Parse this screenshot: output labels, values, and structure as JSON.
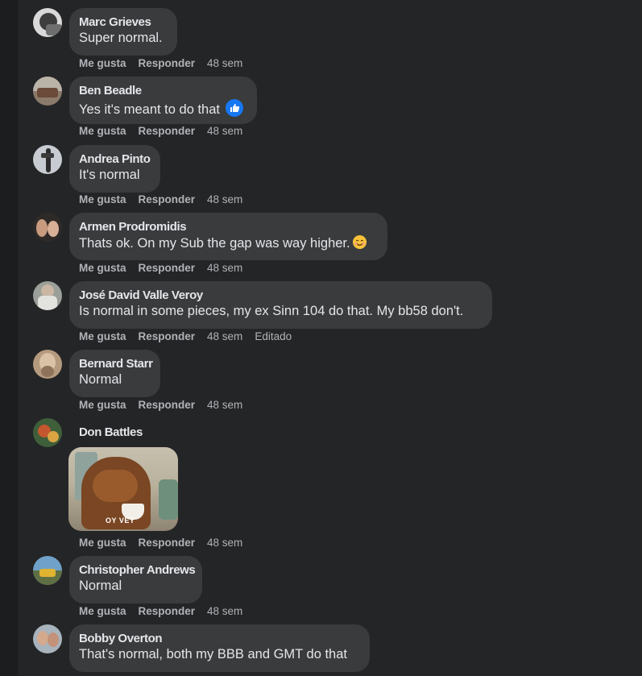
{
  "actions": {
    "like": "Me gusta",
    "reply": "Responder",
    "time": "48 sem",
    "edited": "Editado"
  },
  "comments": [
    {
      "author": "Marc Grieves",
      "text": "Super normal."
    },
    {
      "author": "Ben Beadle",
      "text": "Yes it's meant to do that"
    },
    {
      "author": "Andrea Pinto",
      "text": "It's normal"
    },
    {
      "author": "Armen Prodromidis",
      "text": "Thats ok. On my Sub the gap was way higher."
    },
    {
      "author": "José David Valle Veroy",
      "text": "Is normal in some pieces, my ex Sinn 104 do that. My bb58 don't."
    },
    {
      "author": "Bernard Starr",
      "text": "Normal"
    },
    {
      "author": "Don Battles",
      "gif_caption": "OY VEY"
    },
    {
      "author": "Christopher Andrews",
      "text": "Normal"
    },
    {
      "author": "Bobby Overton",
      "text": "That's normal, both my BBB and GMT do that"
    }
  ],
  "colors": {
    "bg": "#242526",
    "bubble": "#3a3b3c",
    "text": "#e4e6eb",
    "muted": "#b0b3b8",
    "like_blue": "#1877f2"
  },
  "icons": {
    "like_reaction": "thumbs-up-icon",
    "smile_emoji": "smiling-face-icon"
  }
}
